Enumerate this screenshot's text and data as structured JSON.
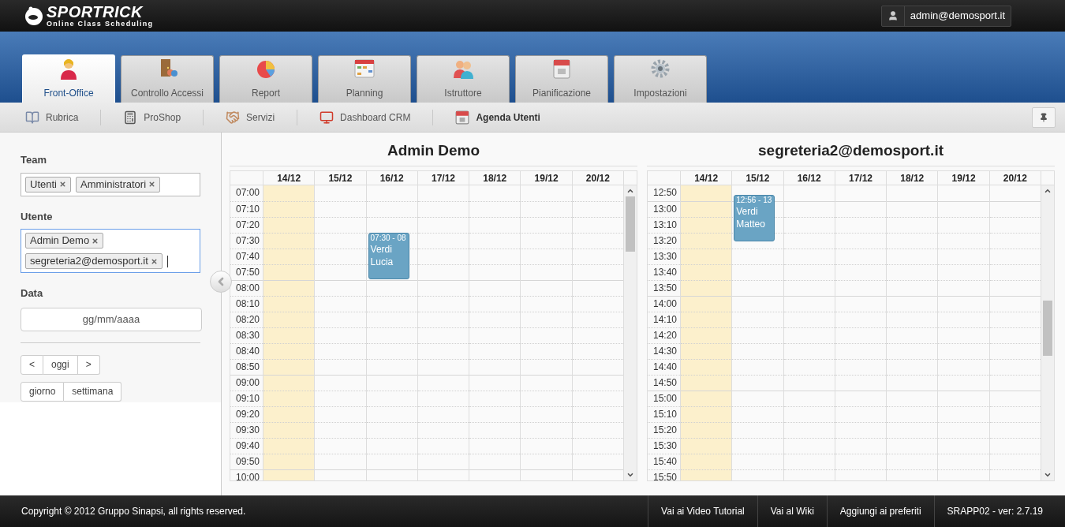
{
  "header": {
    "logo_title": "SPORTRICK",
    "logo_subtitle": "Online Class Scheduling",
    "user": "admin@demosport.it"
  },
  "tabs": [
    {
      "label": "Front-Office",
      "selected": true
    },
    {
      "label": "Controllo Accessi",
      "selected": false
    },
    {
      "label": "Report",
      "selected": false
    },
    {
      "label": "Planning",
      "selected": false
    },
    {
      "label": "Istruttore",
      "selected": false
    },
    {
      "label": "Pianificazione",
      "selected": false
    },
    {
      "label": "Impostazioni",
      "selected": false
    }
  ],
  "subnav": [
    {
      "label": "Rubrica",
      "selected": false
    },
    {
      "label": "ProShop",
      "selected": false
    },
    {
      "label": "Servizi",
      "selected": false
    },
    {
      "label": "Dashboard CRM",
      "selected": false
    },
    {
      "label": "Agenda Utenti",
      "selected": true
    }
  ],
  "sidebar": {
    "team": {
      "label": "Team",
      "chips": [
        "Utenti",
        "Amministratori"
      ],
      "focused": false
    },
    "utente": {
      "label": "Utente",
      "chips": [
        "Admin Demo",
        "segreteria2@demosport.it"
      ],
      "focused": true
    },
    "data": {
      "label": "Data",
      "placeholder": "gg/mm/aaaa"
    },
    "nav_buttons": [
      "<",
      "oggi",
      ">"
    ],
    "view_buttons": [
      "giorno",
      "settimana"
    ]
  },
  "calendars": [
    {
      "title": "Admin Demo",
      "days": [
        {
          "label": "14/12",
          "today": true
        },
        {
          "label": "15/12",
          "today": false
        },
        {
          "label": "16/12",
          "today": false,
          "events": [
            {
              "time": "07:30 - 08",
              "name": "Verdi Lucia"
            }
          ]
        },
        {
          "label": "17/12",
          "today": false
        },
        {
          "label": "18/12",
          "today": false
        },
        {
          "label": "19/12",
          "today": false
        },
        {
          "label": "20/12",
          "today": false
        }
      ],
      "times": [
        "07:00",
        "07:10",
        "07:20",
        "07:30",
        "07:40",
        "07:50",
        "08:00",
        "08:10",
        "08:20",
        "08:30",
        "08:40",
        "08:50",
        "09:00",
        "09:10",
        "09:20",
        "09:30",
        "09:40",
        "09:50",
        "10:00"
      ]
    },
    {
      "title": "segreteria2@demosport.it",
      "days": [
        {
          "label": "14/12",
          "today": true
        },
        {
          "label": "15/12",
          "today": false,
          "events": [
            {
              "time": "12:56 - 13",
              "name": "Verdi Matteo"
            }
          ]
        },
        {
          "label": "16/12",
          "today": false
        },
        {
          "label": "17/12",
          "today": false
        },
        {
          "label": "18/12",
          "today": false
        },
        {
          "label": "19/12",
          "today": false
        },
        {
          "label": "20/12",
          "today": false
        }
      ],
      "times": [
        "12:50",
        "13:00",
        "13:10",
        "13:20",
        "13:30",
        "13:40",
        "13:50",
        "14:00",
        "14:10",
        "14:20",
        "14:30",
        "14:40",
        "14:50",
        "15:00",
        "15:10",
        "15:20",
        "15:30",
        "15:40",
        "15:50"
      ]
    }
  ],
  "footer": {
    "copyright": "Copyright © 2012 Gruppo Sinapsi, all rights reserved.",
    "links": [
      "Vai ai Video Tutorial",
      "Vai al Wiki",
      "Aggiungi ai preferiti",
      "SRAPP02 - ver: 2.7.19"
    ]
  }
}
